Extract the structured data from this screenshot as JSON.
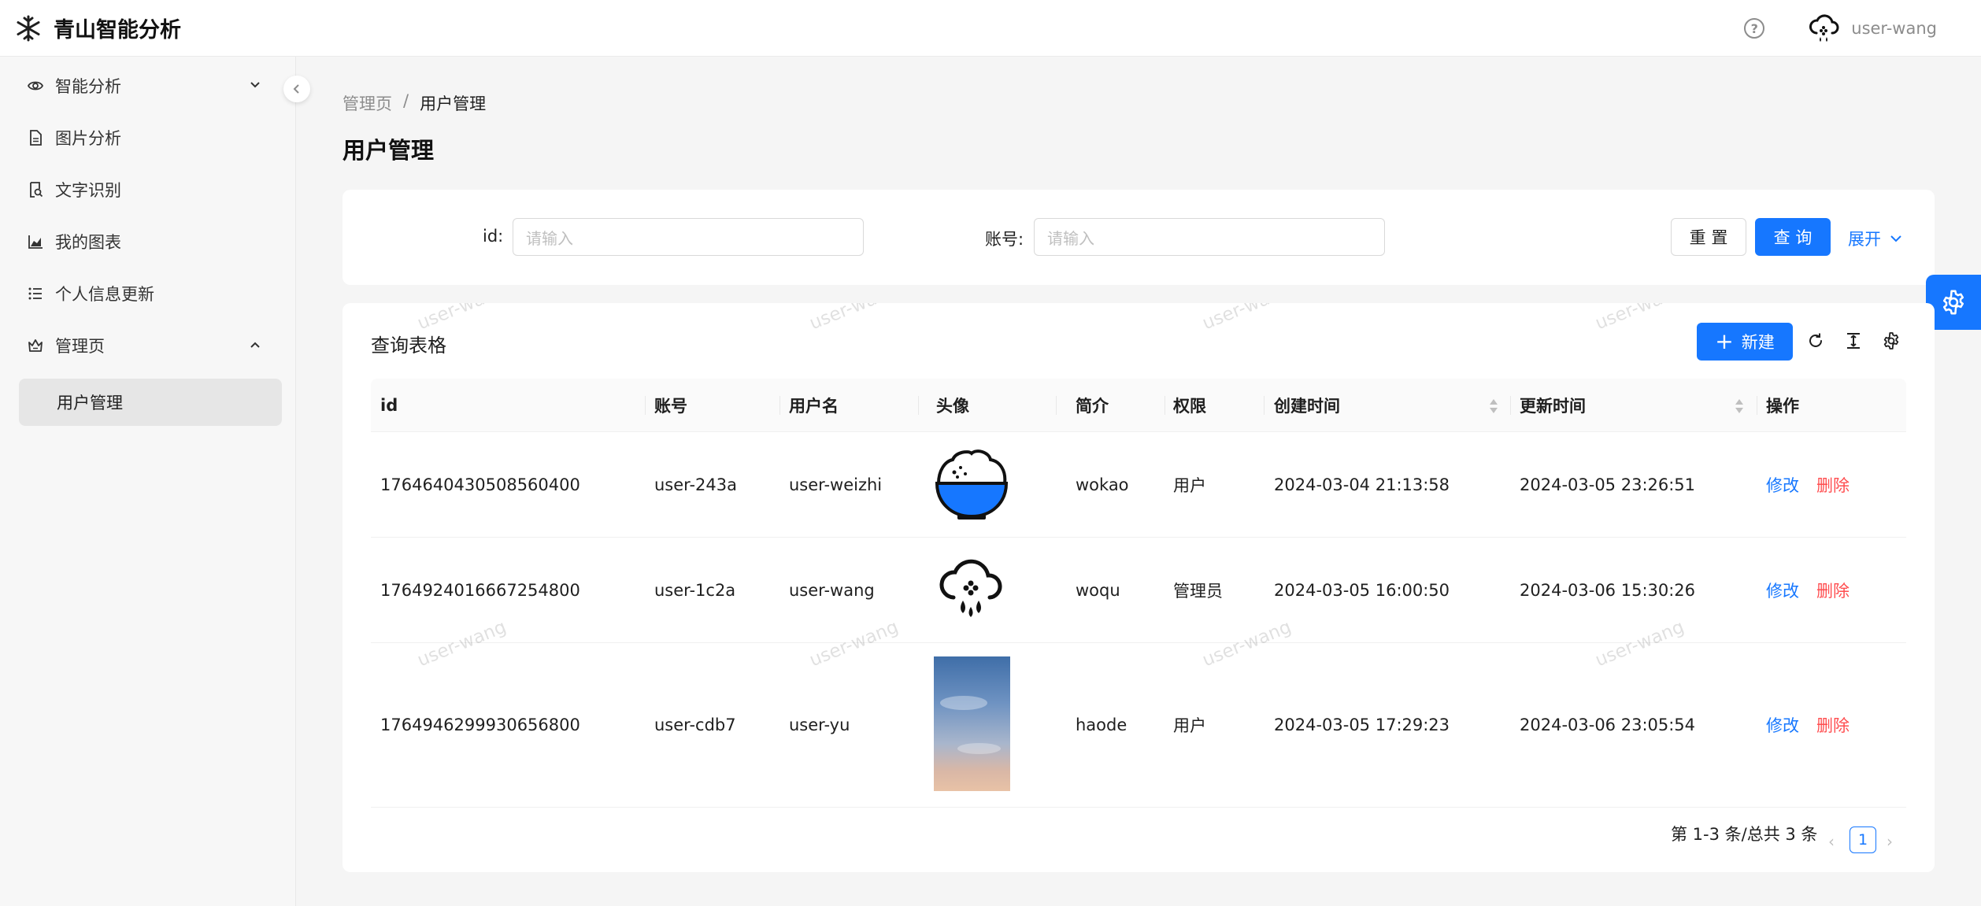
{
  "app": {
    "title": "青山智能分析"
  },
  "header": {
    "help_icon": "question-circle-icon",
    "username": "user-wang"
  },
  "sidebar": {
    "items": [
      {
        "label": "智能分析",
        "icon": "eye-icon",
        "expandable": true,
        "expanded": false
      },
      {
        "label": "图片分析",
        "icon": "file-image-icon"
      },
      {
        "label": "文字识别",
        "icon": "file-search-icon"
      },
      {
        "label": "我的图表",
        "icon": "area-chart-icon"
      },
      {
        "label": "个人信息更新",
        "icon": "list-icon"
      },
      {
        "label": "管理页",
        "icon": "crown-icon",
        "expandable": true,
        "expanded": true
      }
    ],
    "sub_item": {
      "label": "用户管理",
      "active": true
    }
  },
  "breadcrumb": {
    "parent": "管理页",
    "separator": "/",
    "current": "用户管理"
  },
  "page": {
    "title": "用户管理"
  },
  "search": {
    "id_label": "id",
    "colon": ":",
    "id_placeholder": "请输入",
    "account_label": "账号",
    "account_placeholder": "请输入",
    "reset_label": "重 置",
    "query_label": "查 询",
    "expand_label": "展开"
  },
  "table": {
    "title": "查询表格",
    "new_label": "新建",
    "columns": [
      "id",
      "账号",
      "用户名",
      "头像",
      "简介",
      "权限",
      "创建时间",
      "更新时间",
      "操作"
    ],
    "rows": [
      {
        "id": "1764640430508560400",
        "account": "user-243a",
        "username": "user-weizhi",
        "avatar": "rice-bowl",
        "intro": "wokao",
        "role": "用户",
        "created": "2024-03-04 21:13:58",
        "updated": "2024-03-05 23:26:51",
        "edit": "修改",
        "delete": "删除"
      },
      {
        "id": "1764924016667254800",
        "account": "user-1c2a",
        "username": "user-wang",
        "avatar": "snow-cloud",
        "intro": "woqu",
        "role": "管理员",
        "created": "2024-03-05 16:00:50",
        "updated": "2024-03-06 15:30:26",
        "edit": "修改",
        "delete": "删除"
      },
      {
        "id": "1764946299930656800",
        "account": "user-cdb7",
        "username": "user-yu",
        "avatar": "sky-photo",
        "intro": "haode",
        "role": "用户",
        "created": "2024-03-05 17:29:23",
        "updated": "2024-03-06 23:05:54",
        "edit": "修改",
        "delete": "删除"
      }
    ]
  },
  "pagination": {
    "summary": "第 1-3 条/总共 3 条",
    "current_page": "1"
  },
  "watermark": "user-wang",
  "colors": {
    "primary": "#1677ff",
    "danger": "#ff4d4f"
  }
}
